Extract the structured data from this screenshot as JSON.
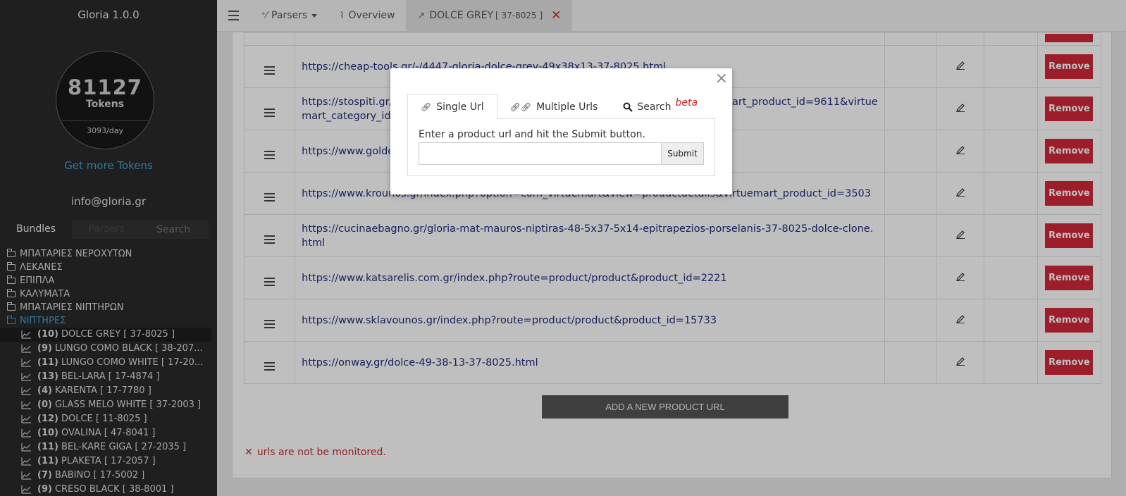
{
  "app": {
    "title": "Gloria 1.0.0"
  },
  "tokens": {
    "count": "81127",
    "label": "Tokens",
    "rate": "3093/day"
  },
  "sidebar": {
    "get_more": "Get more Tokens",
    "email": "info@gloria.gr",
    "tabs": {
      "bundles": "Bundles",
      "parsers": "Parsers",
      "search_placeholder": "Search"
    },
    "folders": [
      {
        "label": "ΜΠΑΤΑΡΙΕΣ ΝΕΡΟΧΥΤΩΝ"
      },
      {
        "label": "ΛΕΚΑΝΕΣ"
      },
      {
        "label": "ΕΠΙΠΛΑ"
      },
      {
        "label": "ΚΑΛΥΜΑΤΑ"
      },
      {
        "label": "ΜΠΑΤΑΡΙΕΣ ΝΙΠΤΗΡΩΝ"
      },
      {
        "label": "ΝΙΠΤΗΡΕΣ"
      }
    ],
    "bundles": [
      {
        "count": "(10)",
        "name": "DOLCE GREY [ 37-8025 ]"
      },
      {
        "count": "(9)",
        "name": "LUNGO COMO BLACK [ 38-207..."
      },
      {
        "count": "(11)",
        "name": "LUNGO COMO WHITE [ 17-20..."
      },
      {
        "count": "(13)",
        "name": "BEL-LARA [ 17-4874 ]"
      },
      {
        "count": "(4)",
        "name": "KARENTA [ 17-7780 ]"
      },
      {
        "count": "(0)",
        "name": "GLASS MELO WHITE [ 37-2003 ]"
      },
      {
        "count": "(12)",
        "name": "DOLCE [ 11-8025 ]"
      },
      {
        "count": "(10)",
        "name": "OVALINA [ 47-8041 ]"
      },
      {
        "count": "(11)",
        "name": "BEL-KARE GIGA [ 27-2035 ]"
      },
      {
        "count": "(11)",
        "name": "PLAKETA [ 17-2057 ]"
      },
      {
        "count": "(7)",
        "name": "BABINO [ 17-5002 ]"
      },
      {
        "count": "(9)",
        "name": "CRESO BLACK [ 38-8001 ]"
      }
    ]
  },
  "topbar": {
    "parsers": "Parsers",
    "overview": "Overview",
    "active_tab": "DOLCE GREY",
    "active_tab_code": "[ 37-8025 ]",
    "close_glyph": "✕"
  },
  "table": {
    "remove_label": "Remove",
    "rows": [
      {
        "url": "https://cheap-tools.gr/-/4447-gloria-dolce-grey-49x38x13-37-8025.html"
      },
      {
        "url": "https://stospiti.gr/index.php?option=com_virtuemart&view=productdetails&virtuemart_product_id=9611&virtuemart_category_id=216&lang=el"
      },
      {
        "url": "https://www.goldenhome.gr/product/gloria-dolce-49x38x13-37-8025?color=anthraki"
      },
      {
        "url": "https://www.krounos.gr/index.php?option=com_virtuemart&view=productdetails&virtuemart_product_id=3503"
      },
      {
        "url": "https://cucinaebagno.gr/gloria-mat-mauros-niptiras-48-5x37-5x14-epitrapezios-porselanis-37-8025-dolce-clone.html"
      },
      {
        "url": "https://www.katsarelis.com.gr/index.php?route=product/product&product_id=2221"
      },
      {
        "url": "https://www.sklavounos.gr/index.php?route=product/product&product_id=15733"
      },
      {
        "url": "https://onway.gr/dolce-49-38-13-37-8025.html"
      }
    ]
  },
  "add_button": "ADD A NEW PRODUCT URL",
  "warning": {
    "icon": "✕",
    "text": "urls are not be monitored."
  },
  "modal": {
    "close": "×",
    "tabs": {
      "single": "Single Url",
      "multiple": "Multiple Urls",
      "search": "Search",
      "beta": "beta"
    },
    "hint": "Enter a product url and hit the Submit button.",
    "input_value": "",
    "submit": "Submit"
  },
  "colors": {
    "accent_blue": "#3fa3d6",
    "remove_red": "#d0293a",
    "link_navy": "#1f2d7a",
    "sidebar_bg": "#2a2a2a"
  }
}
